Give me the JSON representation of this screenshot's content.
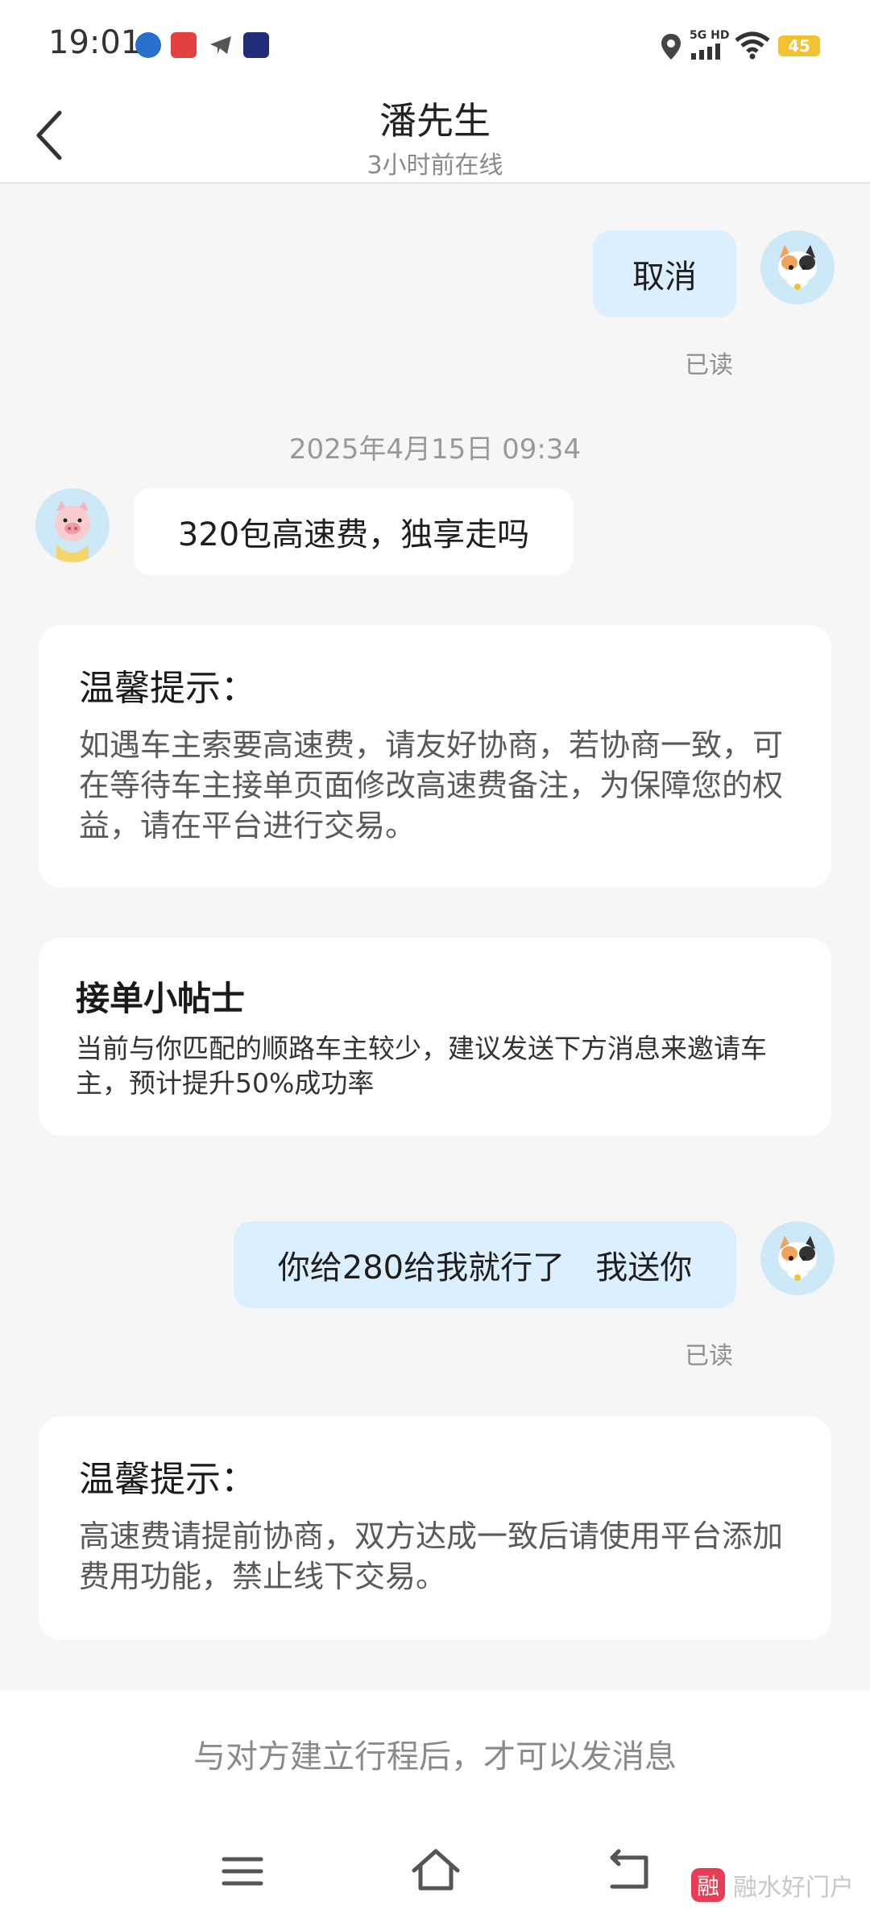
{
  "status_bar": {
    "time": "19:01",
    "network": "5G HD",
    "battery": "45"
  },
  "header": {
    "back_icon": "chevron-left-icon",
    "title": "潘先生",
    "subtitle": "3小时前在线"
  },
  "messages": [
    {
      "side": "me",
      "text": "取消",
      "read": "已读"
    },
    {
      "timestamp": "2025年4月15日 09:34"
    },
    {
      "side": "them",
      "text": "320包高速费，独享走吗"
    },
    {
      "side": "me",
      "text": "你给280给我就行了   我送你",
      "read": "已读"
    }
  ],
  "cards": {
    "warm_tip_1": {
      "title": "温馨提示：",
      "body": "如遇车主索要高速费，请友好协商，若协商一致，可在等待车主接单页面修改高速费备注，为保障您的权益，请在平台进行交易。"
    },
    "order_tip": {
      "title": "接单小帖士",
      "body": "当前与你匹配的顺路车主较少，建议发送下方消息来邀请车主，预计提升50%成功率"
    },
    "warm_tip_2": {
      "title": "温馨提示：",
      "body": "高速费请提前协商，双方达成一致后请使用平台添加费用功能，禁止线下交易。"
    }
  },
  "bottom": {
    "notice": "与对方建立行程后，才可以发消息"
  },
  "watermark": {
    "logo_char": "融",
    "text": "融水好门户"
  },
  "colors": {
    "my_bubble": "#dcefff",
    "their_bubble": "#ffffff",
    "background": "#f6f6f6",
    "watermark_logo": "#e83d55"
  }
}
